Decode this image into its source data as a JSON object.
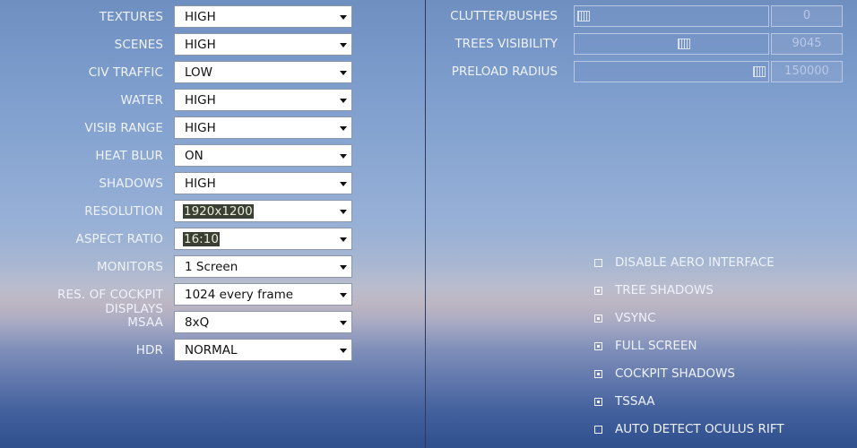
{
  "settings": [
    {
      "label": "TEXTURES",
      "value": "HIGH",
      "highlighted": false
    },
    {
      "label": "SCENES",
      "value": "HIGH",
      "highlighted": false
    },
    {
      "label": "CIV TRAFFIC",
      "value": "LOW",
      "highlighted": false
    },
    {
      "label": "WATER",
      "value": "HIGH",
      "highlighted": false
    },
    {
      "label": "VISIB RANGE",
      "value": "HIGH",
      "highlighted": false
    },
    {
      "label": "HEAT BLUR",
      "value": "ON",
      "highlighted": false
    },
    {
      "label": "SHADOWS",
      "value": "HIGH",
      "highlighted": false
    },
    {
      "label": "RESOLUTION",
      "value": "1920x1200",
      "highlighted": true
    },
    {
      "label": "ASPECT RATIO",
      "value": "16:10",
      "highlighted": true
    },
    {
      "label": "MONITORS",
      "value": "1 Screen",
      "highlighted": false
    },
    {
      "label": "RES. OF COCKPIT DISPLAYS",
      "value": "1024 every frame",
      "highlighted": false
    },
    {
      "label": "MSAA",
      "value": "8xQ",
      "highlighted": false
    },
    {
      "label": "HDR",
      "value": "NORMAL",
      "highlighted": false
    }
  ],
  "sliders": [
    {
      "label": "CLUTTER/BUSHES",
      "value": "0",
      "fraction": 0.0
    },
    {
      "label": "TREES VISIBILITY",
      "value": "9045",
      "fraction": 0.57
    },
    {
      "label": "PRELOAD RADIUS",
      "value": "150000",
      "fraction": 1.0
    }
  ],
  "checkboxes": [
    {
      "label": "DISABLE AERO INTERFACE",
      "checked": false
    },
    {
      "label": "TREE SHADOWS",
      "checked": true
    },
    {
      "label": "VSYNC",
      "checked": true
    },
    {
      "label": "FULL SCREEN",
      "checked": true
    },
    {
      "label": "COCKPIT SHADOWS",
      "checked": true
    },
    {
      "label": "TSSAA",
      "checked": true
    },
    {
      "label": "AUTO DETECT OCULUS RIFT",
      "checked": false
    }
  ]
}
